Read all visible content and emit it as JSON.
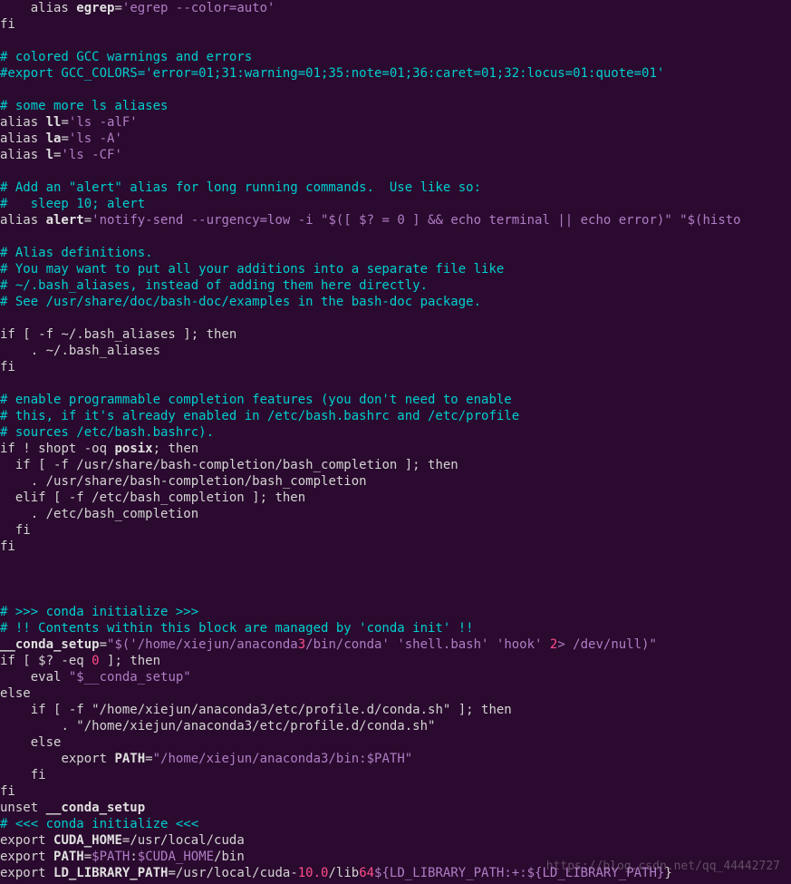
{
  "code_lines": [
    "    alias egrep='egrep --color=auto'",
    "fi",
    "",
    "# colored GCC warnings and errors",
    "#export GCC_COLORS='error=01;31:warning=01;35:note=01;36:caret=01;32:locus=01:quote=01'",
    "",
    "# some more ls aliases",
    "alias ll='ls -alF'",
    "alias la='ls -A'",
    "alias l='ls -CF'",
    "",
    "# Add an \"alert\" alias for long running commands.  Use like so:",
    "#   sleep 10; alert",
    "alias alert='notify-send --urgency=low -i \"$([ $? = 0 ] && echo terminal || echo error)\" \"$(histo",
    "",
    "# Alias definitions.",
    "# You may want to put all your additions into a separate file like",
    "# ~/.bash_aliases, instead of adding them here directly.",
    "# See /usr/share/doc/bash-doc/examples in the bash-doc package.",
    "",
    "if [ -f ~/.bash_aliases ]; then",
    "    . ~/.bash_aliases",
    "fi",
    "",
    "# enable programmable completion features (you don't need to enable",
    "# this, if it's already enabled in /etc/bash.bashrc and /etc/profile",
    "# sources /etc/bash.bashrc).",
    "if ! shopt -oq posix; then",
    "  if [ -f /usr/share/bash-completion/bash_completion ]; then",
    "    . /usr/share/bash-completion/bash_completion",
    "  elif [ -f /etc/bash_completion ]; then",
    "    . /etc/bash_completion",
    "  fi",
    "fi",
    "",
    "",
    "",
    "# >>> conda initialize >>>",
    "# !! Contents within this block are managed by 'conda init' !!",
    "__conda_setup=\"$('/home/xiejun/anaconda3/bin/conda' 'shell.bash' 'hook' 2> /dev/null)\"",
    "if [ $? -eq 0 ]; then",
    "    eval \"$__conda_setup\"",
    "else",
    "    if [ -f \"/home/xiejun/anaconda3/etc/profile.d/conda.sh\" ]; then",
    "        . \"/home/xiejun/anaconda3/etc/profile.d/conda.sh\"",
    "    else",
    "        export PATH=\"/home/xiejun/anaconda3/bin:$PATH\"",
    "    fi",
    "fi",
    "unset __conda_setup",
    "# <<< conda initialize <<<",
    "export CUDA_HOME=/usr/local/cuda",
    "export PATH=$PATH:$CUDA_HOME/bin",
    "export LD_LIBRARY_PATH=/usr/local/cuda-10.0/lib64${LD_LIBRARY_PATH:+:${LD_LIBRARY_PATH}}"
  ],
  "watermark": "https://blog.csdn.net/qq_44442727"
}
